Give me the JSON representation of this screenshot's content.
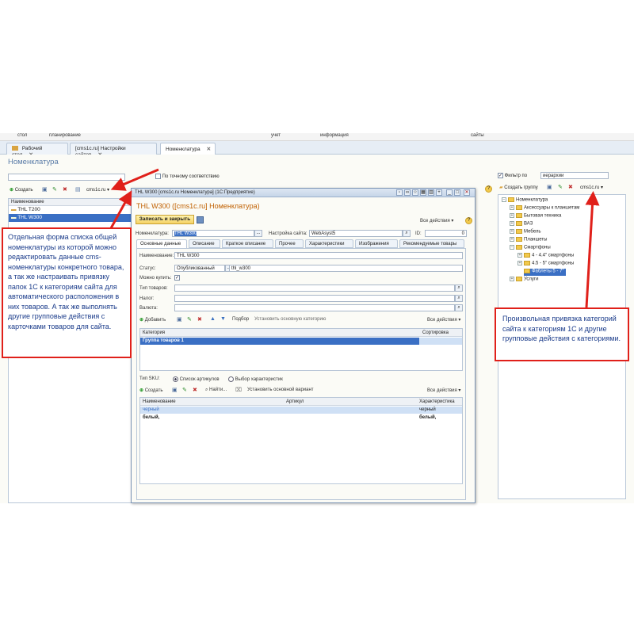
{
  "top_menu": [
    "стол",
    "планирование",
    "учет",
    "информация",
    "сайты"
  ],
  "tabs": [
    {
      "label": "Рабочий стол"
    },
    {
      "label": "[cms1c.ru] Настройки сайтов"
    },
    {
      "label": "Номенклатура"
    }
  ],
  "page": {
    "title": "Номенклатура",
    "search_exact_label": "По точному соответствию",
    "create_label": "Создать",
    "site_label": "cms1c.ru",
    "list_header": "Наименование",
    "list_items": [
      "THL T200",
      "THL W300"
    ]
  },
  "right_panel": {
    "filter_label": "Фильтр по",
    "filter_value": "иерархии",
    "create_group_label": "Создать группу",
    "site_label": "cms1c.ru",
    "tree": [
      {
        "label": "Номенклатура",
        "level": 0
      },
      {
        "label": "Аксессуары к планшетам",
        "level": 1
      },
      {
        "label": "Бытовая техника",
        "level": 1
      },
      {
        "label": "ВАЗ",
        "level": 1
      },
      {
        "label": "Мебель",
        "level": 1
      },
      {
        "label": "Планшеты",
        "level": 1
      },
      {
        "label": "Смартфоны",
        "level": 1
      },
      {
        "label": "4 - 4.4\" смартфоны",
        "level": 2
      },
      {
        "label": "4.5 - 5\" смартфоны",
        "level": 2
      },
      {
        "label": "Фаблеты 5 - 7\"",
        "level": 2
      },
      {
        "label": "Услуги",
        "level": 1
      }
    ]
  },
  "dialog": {
    "window_title": "THL W300 [cms1c.ru Номенклатура] (1С:Предприятие)",
    "heading": "THL W300 ([cms1c.ru] Номенклатура)",
    "save_close": "Записать и закрыть",
    "all_actions": "Все действия",
    "nomenclature_label": "Номенклатура:",
    "nomenclature_value": "THL W300",
    "site_setting_label": "Настройка сайта:",
    "site_setting_value": "WebAsyst5",
    "id_label": "ID:",
    "id_value": "0",
    "tabs": [
      "Основные данные",
      "Описание",
      "Краткое описание",
      "Прочее",
      "Характеристики",
      "Изображения",
      "Рекомендуемые товары"
    ],
    "name_label": "Наименование:",
    "name_value": "THL W300",
    "status_label": "Статус:",
    "status_value": "Опубликованный",
    "url_value": "thl_w300",
    "can_buy_label": "Можно купить:",
    "product_type_label": "Тип товаров:",
    "tax_label": "Налог:",
    "currency_label": "Валюта:",
    "add_label": "Добавить",
    "select_label": "Подбор",
    "set_main_category": "Установить основную категорию",
    "category_table": {
      "headers": [
        "Категория",
        "Сортировка"
      ],
      "rows": [
        [
          "Группа товаров 1",
          ""
        ]
      ]
    },
    "sku_type_label": "Тип SKU:",
    "sku_option1": "Список артикулов",
    "sku_option2": "Выбор характеристик",
    "create_label": "Создать",
    "find_label": "Найти...",
    "set_main_variant": "Установить основной вариант",
    "sku_table": {
      "headers": [
        "Наименование",
        "Артикул",
        "Характеристика"
      ],
      "rows": [
        [
          "черный",
          "",
          "черный"
        ],
        [
          "белый,",
          "",
          "белый,"
        ]
      ]
    }
  },
  "annotations": {
    "left_note": "Отдельная форма списка общей номенклатуры из которой можно редактировать данные cms-номенклатуры конкретного товара, а так же настраивать привязку папок 1С к категориям сайта для автоматического расположения в них товаров. А так же выполнять другие групповые действия с карточками товаров для сайта.",
    "right_note": "Произвольная привязка категорий сайта к категориям 1С и другие групповые действия с категориями."
  },
  "colors": {
    "accent": "#3a6fc4",
    "annotation_red": "#e0201a",
    "annotation_text": "#1a3b8a",
    "heading_orange": "#c06000"
  }
}
